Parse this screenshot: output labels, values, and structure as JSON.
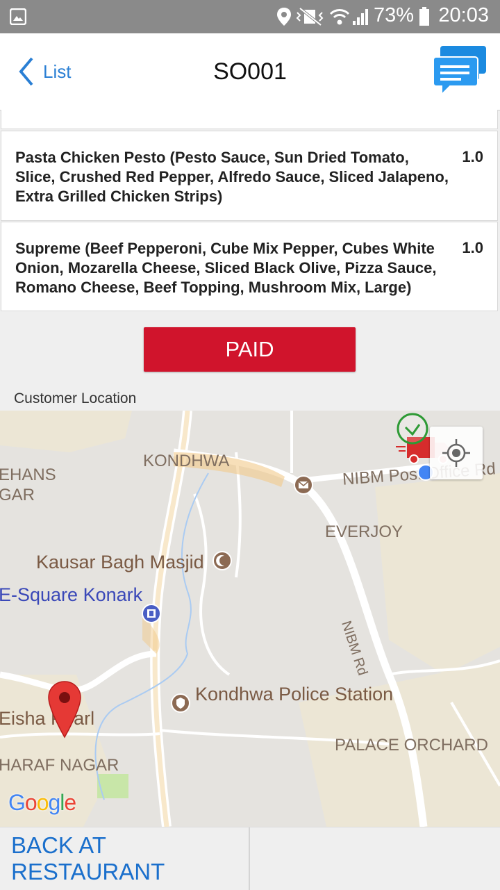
{
  "status_bar": {
    "battery": "73%",
    "time": "20:03"
  },
  "nav": {
    "back_label": "List",
    "title": "SO001"
  },
  "items": [
    {
      "name": "Pasta Chicken Pesto (Pesto Sauce, Sun Dried Tomato, Slice, Crushed Red Pepper, Alfredo Sauce, Sliced Jalapeno, Extra Grilled Chicken Strips)",
      "qty": "1.0"
    },
    {
      "name": "Supreme (Beef Pepperoni, Cube Mix Pepper, Cubes White Onion, Mozarella Cheese, Sliced Black Olive, Pizza Sauce, Romano Cheese, Beef Topping, Mushroom Mix, Large)",
      "qty": "1.0"
    }
  ],
  "paid_label": "PAID",
  "location_label": "Customer Location",
  "map": {
    "labels": {
      "kondhwa": "KONDHWA",
      "nibm_post": "NIBM Post Office Rd",
      "everjoy": "EVERJOY",
      "kausar": "Kausar Bagh Masjid",
      "esquare": "E-Square Konark",
      "nibm_rd": "NIBM Rd",
      "police": "Kondhwa Police Station",
      "eisha": "Eisha Pearl",
      "palace": "PALACE ORCHARD",
      "haraf": "HARAF NAGAR",
      "rehans1": "EHANS",
      "rehans2": "GAR"
    },
    "logo": "Google"
  },
  "bottom_button": "BACK AT RESTAURANT",
  "colors": {
    "accent_blue": "#1a6fcc",
    "paid_red": "#d0142c",
    "pin_red": "#e53935"
  }
}
